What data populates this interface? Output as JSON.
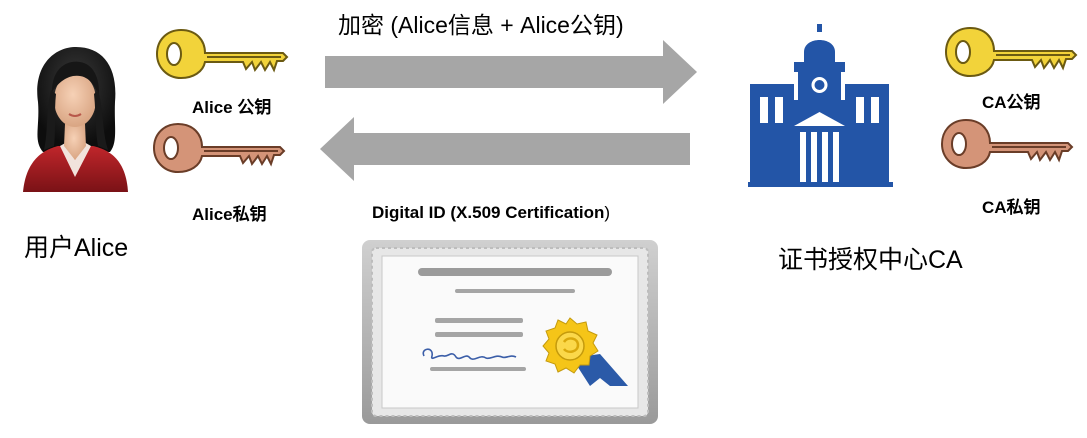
{
  "top_arrow_label": "加密 (Alice信息 + Alice公钥)",
  "bottom_arrow_label_main": "Digital ID (X.509 Certification",
  "bottom_arrow_label_end": ")",
  "user": {
    "name": "用户Alice",
    "public_key_label": "Alice 公钥",
    "private_key_label": "Alice私钥"
  },
  "ca": {
    "name": "证书授权中心CA",
    "public_key_label": "CA公钥",
    "private_key_label": "CA私钥"
  },
  "colors": {
    "public_key": "#F2D33A",
    "private_key": "#D49478",
    "arrow": "#A6A6A6",
    "building": "#2355A7",
    "seal": "#F5C518",
    "ribbon": "#2B5AA8"
  }
}
